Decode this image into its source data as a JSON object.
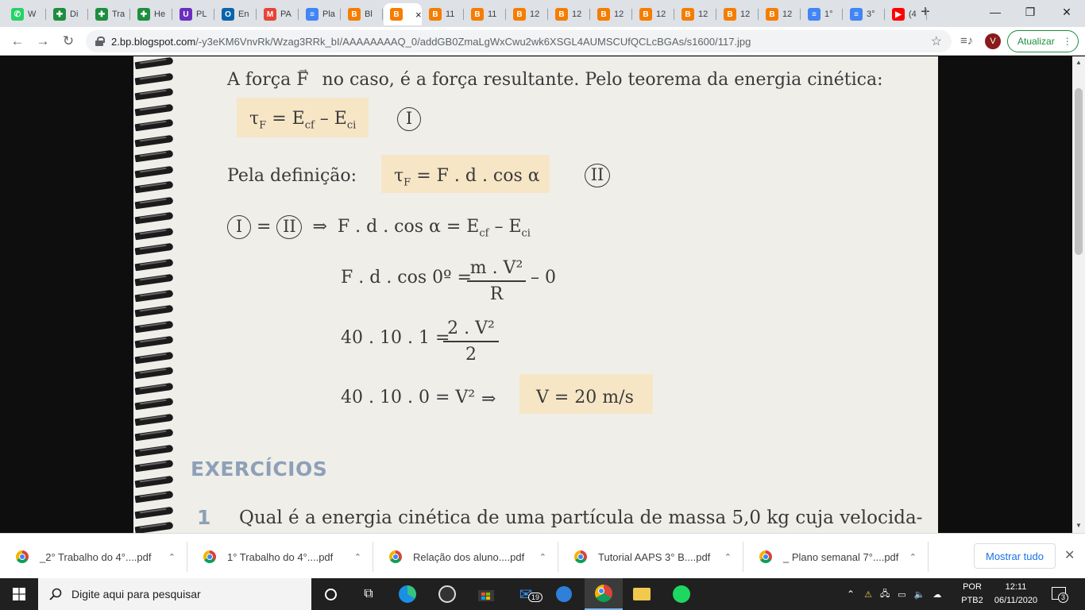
{
  "browser": {
    "tabs": [
      {
        "label": "W",
        "icon": "whatsapp-icon",
        "color": "#25d366",
        "glyph": "✆"
      },
      {
        "label": "Di",
        "icon": "classroom-icon",
        "color": "#1e8e3e",
        "glyph": "✚"
      },
      {
        "label": "Tra",
        "icon": "classroom-icon",
        "color": "#1e8e3e",
        "glyph": "✚"
      },
      {
        "label": "He",
        "icon": "classroom-icon",
        "color": "#1e8e3e",
        "glyph": "✚"
      },
      {
        "label": "PL",
        "icon": "unicesumar-icon",
        "color": "#6b2fbf",
        "glyph": "U"
      },
      {
        "label": "En",
        "icon": "outlook-icon",
        "color": "#0a64ad",
        "glyph": "O"
      },
      {
        "label": "PA",
        "icon": "gmail-icon",
        "color": "#ea4335",
        "glyph": "M"
      },
      {
        "label": "Pla",
        "icon": "docs-icon",
        "color": "#4285f4",
        "glyph": "≡"
      },
      {
        "label": "Bl",
        "icon": "blogger-icon",
        "color": "#f57d00",
        "glyph": "B"
      },
      {
        "label": "",
        "icon": "blogger-icon",
        "color": "#f57d00",
        "glyph": "B",
        "active": true
      },
      {
        "label": "11",
        "icon": "blogger-icon",
        "color": "#f57d00",
        "glyph": "B"
      },
      {
        "label": "11",
        "icon": "blogger-icon",
        "color": "#f57d00",
        "glyph": "B"
      },
      {
        "label": "12",
        "icon": "blogger-icon",
        "color": "#f57d00",
        "glyph": "B"
      },
      {
        "label": "12",
        "icon": "blogger-icon",
        "color": "#f57d00",
        "glyph": "B"
      },
      {
        "label": "12",
        "icon": "blogger-icon",
        "color": "#f57d00",
        "glyph": "B"
      },
      {
        "label": "12",
        "icon": "blogger-icon",
        "color": "#f57d00",
        "glyph": "B"
      },
      {
        "label": "12",
        "icon": "blogger-icon",
        "color": "#f57d00",
        "glyph": "B"
      },
      {
        "label": "12",
        "icon": "blogger-icon",
        "color": "#f57d00",
        "glyph": "B"
      },
      {
        "label": "12",
        "icon": "blogger-icon",
        "color": "#f57d00",
        "glyph": "B"
      },
      {
        "label": "1°",
        "icon": "docs-icon",
        "color": "#4285f4",
        "glyph": "≡"
      },
      {
        "label": "3°",
        "icon": "docs-icon",
        "color": "#4285f4",
        "glyph": "≡"
      },
      {
        "label": "(4",
        "icon": "youtube-icon",
        "color": "#ff0000",
        "glyph": "▶"
      }
    ],
    "tab_close": "×",
    "new_tab": "+",
    "window_controls": {
      "minimize": "—",
      "restore": "❐",
      "close": "✕"
    },
    "url_host": "2.bp.blogspot.com",
    "url_path": "/-y3eKM6VnvRk/Wzag3RRk_bI/AAAAAAAAQ_0/addGB0ZmaLgWxCwu2wk6XSGL4AUMSCUfQCLcBGAs/s1600/117.jpg",
    "profile_initial": "V",
    "update_label": "Atualizar",
    "update_menu": "⋮"
  },
  "page": {
    "line1_a": "A força F",
    "line1_b": "no caso, é a força resultante. Pelo teorema da energia cinética:",
    "eq1": "τ",
    "eq1_sub": "F",
    "eq1_rest": "= E",
    "eq1_sub2": "cf",
    "eq1_minus": "– E",
    "eq1_sub3": "ci",
    "roman1": "I",
    "def_label": "Pela definição:",
    "eq2": "τ",
    "eq2_sub": "F",
    "eq2_rest": "= F . d . cos α",
    "roman2": "II",
    "eq3_eq": "=",
    "eq3_arrow": "⇒",
    "eq3_body": "F . d . cos α = E",
    "eq3_sub": "cf",
    "eq3_minus": "– E",
    "eq3_sub2": "ci",
    "eq4_left": "F . d . cos 0º =",
    "eq4_num": "m . V²",
    "eq4_den": "R",
    "eq4_right": "– 0",
    "eq5_left": "40 . 10 . 1 =",
    "eq5_num": "2 . V²",
    "eq5_den": "2",
    "eq6_left": "40 . 10 . 0 = V²",
    "eq6_arrow": "⇒",
    "eq6_result": "V = 20 m/s",
    "exercises_title": "EXERCÍCIOS",
    "q1_number": "1",
    "q1_text": "Qual é a energia cinética de uma partícula de massa 5,0 kg cuja velocida-"
  },
  "downloads": {
    "items": [
      {
        "name": "_2° Trabalho do 4°....pdf"
      },
      {
        "name": "1° Trabalho do 4°....pdf"
      },
      {
        "name": "Relação dos aluno....pdf"
      },
      {
        "name": "Tutorial AAPS 3° B....pdf"
      },
      {
        "name": "_ Plano semanal 7°....pdf"
      }
    ],
    "caret": "⌃",
    "show_all": "Mostrar tudo",
    "close": "✕"
  },
  "taskbar": {
    "search_placeholder": "Digite aqui para pesquisar",
    "mail_badge": "19",
    "language": "POR",
    "keyboard": "PTB2",
    "time": "12:11",
    "date": "06/11/2020",
    "notifications": "3"
  }
}
